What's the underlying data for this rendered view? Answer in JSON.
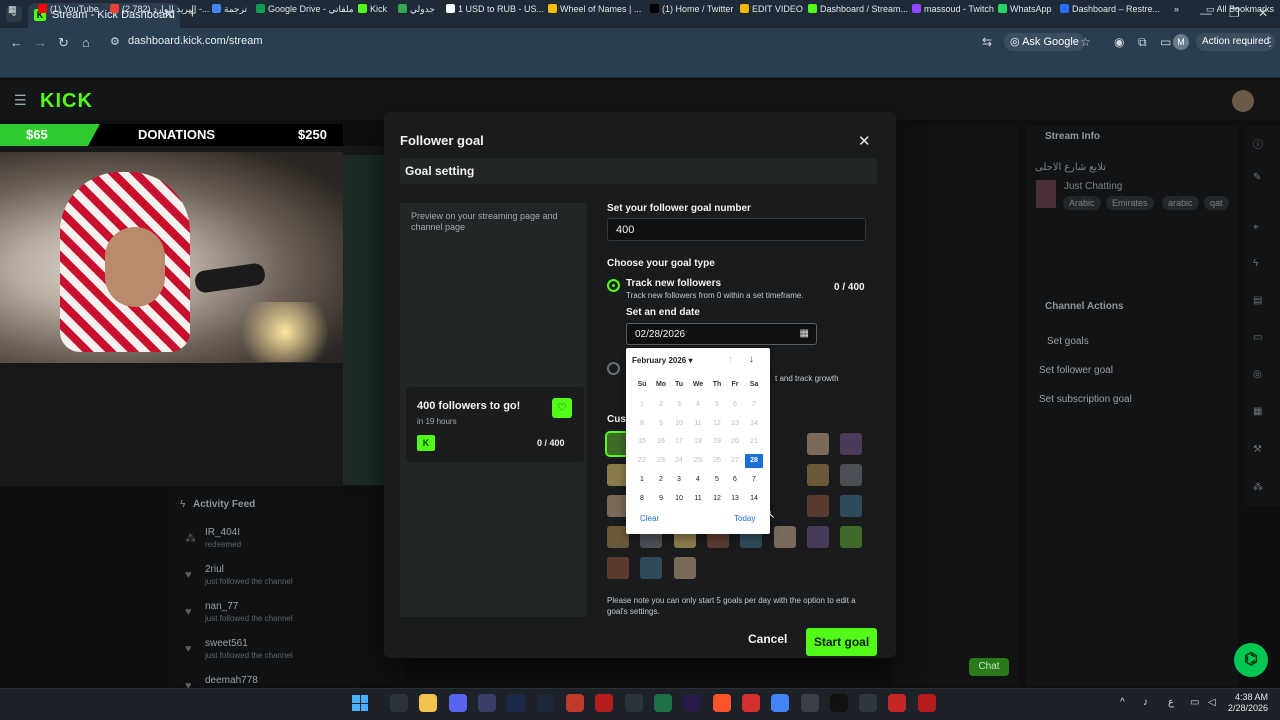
{
  "browser": {
    "tab_title": "Stream - Kick Dashboard",
    "url": "dashboard.kick.com/stream",
    "ask_google": "Ask Google",
    "profile_initial": "M",
    "action_required": "Action required",
    "bookmarks": [
      {
        "label": "(1) YouTube",
        "color": "#ff0000"
      },
      {
        "label": "(2,782) البريد الوارد -...",
        "color": "#ea4335"
      },
      {
        "label": "ترجمة",
        "color": "#4285f4"
      },
      {
        "label": "Google Drive - ملفاتي",
        "color": "#0f9d58"
      },
      {
        "label": "Kick",
        "color": "#53fc18"
      },
      {
        "label": "جدولي",
        "color": "#34a853"
      },
      {
        "label": "1 USD to RUB - US...",
        "color": "#ffffff"
      },
      {
        "label": "Wheel of Names | ...",
        "color": "#fbbc05"
      },
      {
        "label": "(1) Home / Twitter",
        "color": "#000000"
      },
      {
        "label": "EDIT VIDEO",
        "color": "#f4b400"
      },
      {
        "label": "Dashboard / Stream...",
        "color": "#53fc18"
      },
      {
        "label": "massoud - Twitch",
        "color": "#9146ff"
      },
      {
        "label": "WhatsApp",
        "color": "#25d366"
      },
      {
        "label": "Dashboard – Restre...",
        "color": "#2a6cff"
      }
    ],
    "all_bookmarks": "All Bookmarks"
  },
  "overlay": {
    "donation_amount": "$65",
    "donation_label": "DONATIONS",
    "donation_goal": "$250"
  },
  "activity": {
    "title": "Activity Feed",
    "items": [
      {
        "name": "IR_404I",
        "sub": "redeemed"
      },
      {
        "name": "2riul",
        "sub": "just followed the channel"
      },
      {
        "name": "nan_77",
        "sub": "just followed the channel"
      },
      {
        "name": "sweet561",
        "sub": "just followed the channel"
      },
      {
        "name": "deemah778",
        "sub": ""
      }
    ]
  },
  "right": {
    "stream_info": "Stream Info",
    "stream_title": "تلايع شارع الاحلى",
    "category": "Just Chatting",
    "tags": [
      "Arabic",
      "Emirates",
      "arabic",
      "qat"
    ],
    "channel_actions": "Channel Actions",
    "set_goals": "Set goals",
    "set_follower_goal": "Set follower goal",
    "set_subscription_goal": "Set subscription goal",
    "chat_button": "Chat"
  },
  "modal": {
    "title": "Follower goal",
    "section": "Goal setting",
    "preview_text": "Preview on your streaming page and channel page",
    "preview_card_title": "400 followers to go!",
    "preview_card_sub": "in 19 hours",
    "preview_card_count": "0 / 400",
    "goal_number_label": "Set your follower goal number",
    "goal_number_value": "400",
    "goal_type_label": "Choose your goal type",
    "option1_title": "Track new followers",
    "option1_sub": "Track new followers from 0 within a set timeframe.",
    "option1_count": "0 / 400",
    "end_date_label": "Set an end date",
    "end_date_value": "02/28/2026",
    "option2_sub_visible": "t and track growth",
    "custom_label": "Cus",
    "note": "Please note you can only start 5 goals per day with the option to edit a goal's settings.",
    "cancel": "Cancel",
    "start": "Start goal"
  },
  "calendar": {
    "month": "February 2026",
    "weekdays": [
      "Su",
      "Mo",
      "Tu",
      "We",
      "Th",
      "Fr",
      "Sa"
    ],
    "weeks": [
      [
        [
          "1",
          "dis"
        ],
        [
          "2",
          "dis"
        ],
        [
          "3",
          "dis"
        ],
        [
          "4",
          "dis"
        ],
        [
          "5",
          "dis"
        ],
        [
          "6",
          "dis"
        ],
        [
          "7",
          "dis"
        ]
      ],
      [
        [
          "8",
          "dis"
        ],
        [
          "9",
          "dis"
        ],
        [
          "10",
          "dis"
        ],
        [
          "11",
          "dis"
        ],
        [
          "12",
          "dis"
        ],
        [
          "13",
          "dis"
        ],
        [
          "14",
          "dis"
        ]
      ],
      [
        [
          "15",
          "dis"
        ],
        [
          "16",
          "dis"
        ],
        [
          "17",
          "dis"
        ],
        [
          "18",
          "dis"
        ],
        [
          "19",
          "dis"
        ],
        [
          "20",
          "dis"
        ],
        [
          "21",
          "dis"
        ]
      ],
      [
        [
          "22",
          "dis"
        ],
        [
          "23",
          "dis"
        ],
        [
          "24",
          "dis"
        ],
        [
          "25",
          "dis"
        ],
        [
          "26",
          "dis"
        ],
        [
          "27",
          "dis"
        ],
        [
          "28",
          "sel"
        ]
      ],
      [
        [
          "1",
          "en"
        ],
        [
          "2",
          "en"
        ],
        [
          "3",
          "en"
        ],
        [
          "4",
          "en"
        ],
        [
          "5",
          "en"
        ],
        [
          "6",
          "en"
        ],
        [
          "7",
          "en"
        ]
      ],
      [
        [
          "8",
          "en"
        ],
        [
          "9",
          "en"
        ],
        [
          "10",
          "en"
        ],
        [
          "11",
          "en"
        ],
        [
          "12",
          "en"
        ],
        [
          "13",
          "en"
        ],
        [
          "14",
          "en"
        ]
      ]
    ],
    "clear": "Clear",
    "today": "Today"
  },
  "taskbar": {
    "time": "4:38 AM",
    "date": "2/28/2026",
    "lang": "ع"
  }
}
